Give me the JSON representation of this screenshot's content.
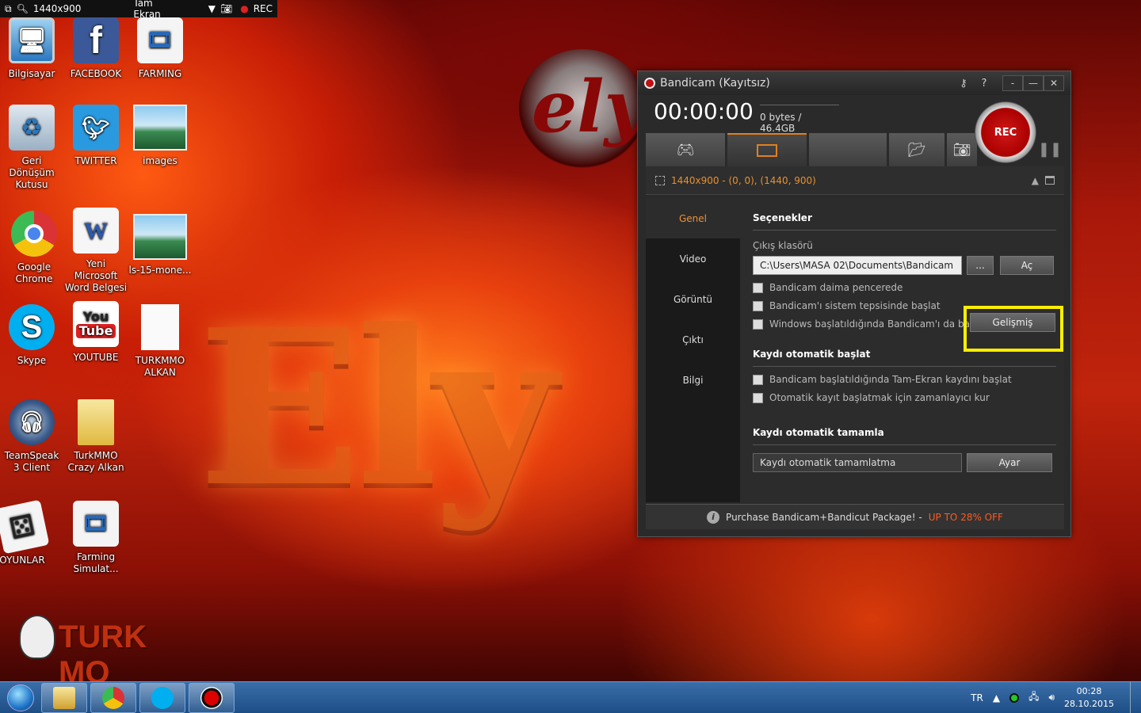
{
  "recbar": {
    "resolution": "1440x900",
    "mode": "Tam Ekran",
    "rec": "REC"
  },
  "desktop_icons": [
    {
      "label": "Bilgisayar"
    },
    {
      "label": "FACEBOOK"
    },
    {
      "label": "FARMING"
    },
    {
      "label": "Geri Dönüşüm Kutusu"
    },
    {
      "label": "TWITTER"
    },
    {
      "label": "images"
    },
    {
      "label": "Google Chrome"
    },
    {
      "label": "Yeni Microsoft Word Belgesi"
    },
    {
      "label": "ls-15-mone..."
    },
    {
      "label": "Skype"
    },
    {
      "label": "YOUTUBE"
    },
    {
      "label": "TURKMMO ALKAN"
    },
    {
      "label": "TeamSpeak 3 Client"
    },
    {
      "label": "TurkMMO Crazy Alkan"
    },
    {
      "label": "OYUNLAR"
    },
    {
      "label": "Farming Simulat..."
    }
  ],
  "bandicam": {
    "title": "Bandicam (Kayıtsız)",
    "timer": "00:00:00",
    "size": "0 bytes / 46.4GB",
    "rec_label": "REC",
    "region": "1440x900 - (0, 0), (1440, 900)",
    "sidebar": [
      "Genel",
      "Video",
      "Görüntü",
      "Çıktı",
      "Bilgi"
    ],
    "options_title": "Seçenekler",
    "output_folder_label": "Çıkış klasörü",
    "output_folder": "C:\\Users\\MASA 02\\Documents\\Bandicam",
    "browse_label": "...",
    "open_label": "Aç",
    "checks_general": [
      "Bandicam daima pencerede",
      "Bandicam'ı sistem tepsisinde başlat",
      "Windows başlatıldığında Bandicam'ı da başlat"
    ],
    "advanced_label": "Gelişmiş",
    "auto_start_title": "Kaydı otomatik başlat",
    "checks_auto": [
      "Bandicam başlatıldığında Tam-Ekran kaydını başlat",
      "Otomatik kayıt başlatmak için zamanlayıcı kur"
    ],
    "auto_complete_title": "Kaydı otomatik tamamla",
    "auto_complete_value": "Kaydı otomatik tamamlatma",
    "settings_label": "Ayar",
    "footer_text": "Purchase Bandicam+Bandicut Package! -",
    "footer_promo": "UP TO 28% OFF",
    "highlight_color": "#ffee00"
  },
  "taskbar": {
    "lang": "TR",
    "time": "00:28",
    "date": "28.10.2015"
  }
}
